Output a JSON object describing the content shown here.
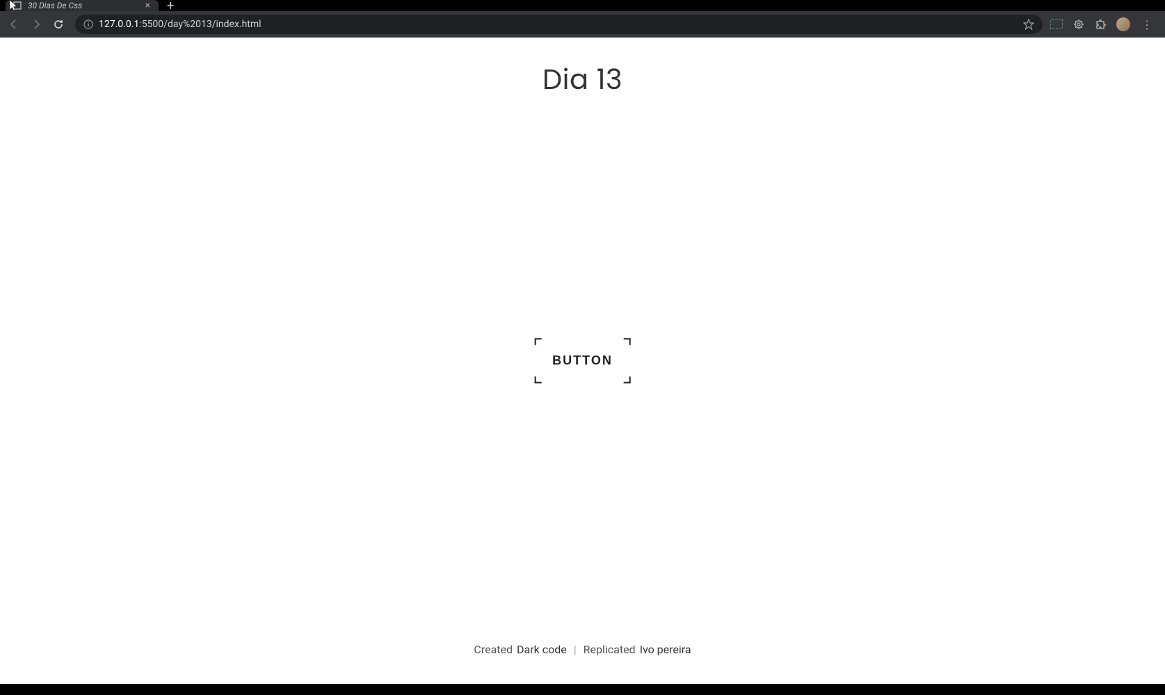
{
  "browser": {
    "tab_title": "30 Dias De Css",
    "url_host": "127.0.0.1",
    "url_port": ":5500",
    "url_path": "/day%2013/index.html"
  },
  "page": {
    "title": "Dia 13",
    "button_label": "BUTTON"
  },
  "footer": {
    "created_label": "Created",
    "created_by": "Dark code",
    "separator": "|",
    "replicated_label": "Replicated",
    "replicated_by": "Ivo pereira"
  }
}
